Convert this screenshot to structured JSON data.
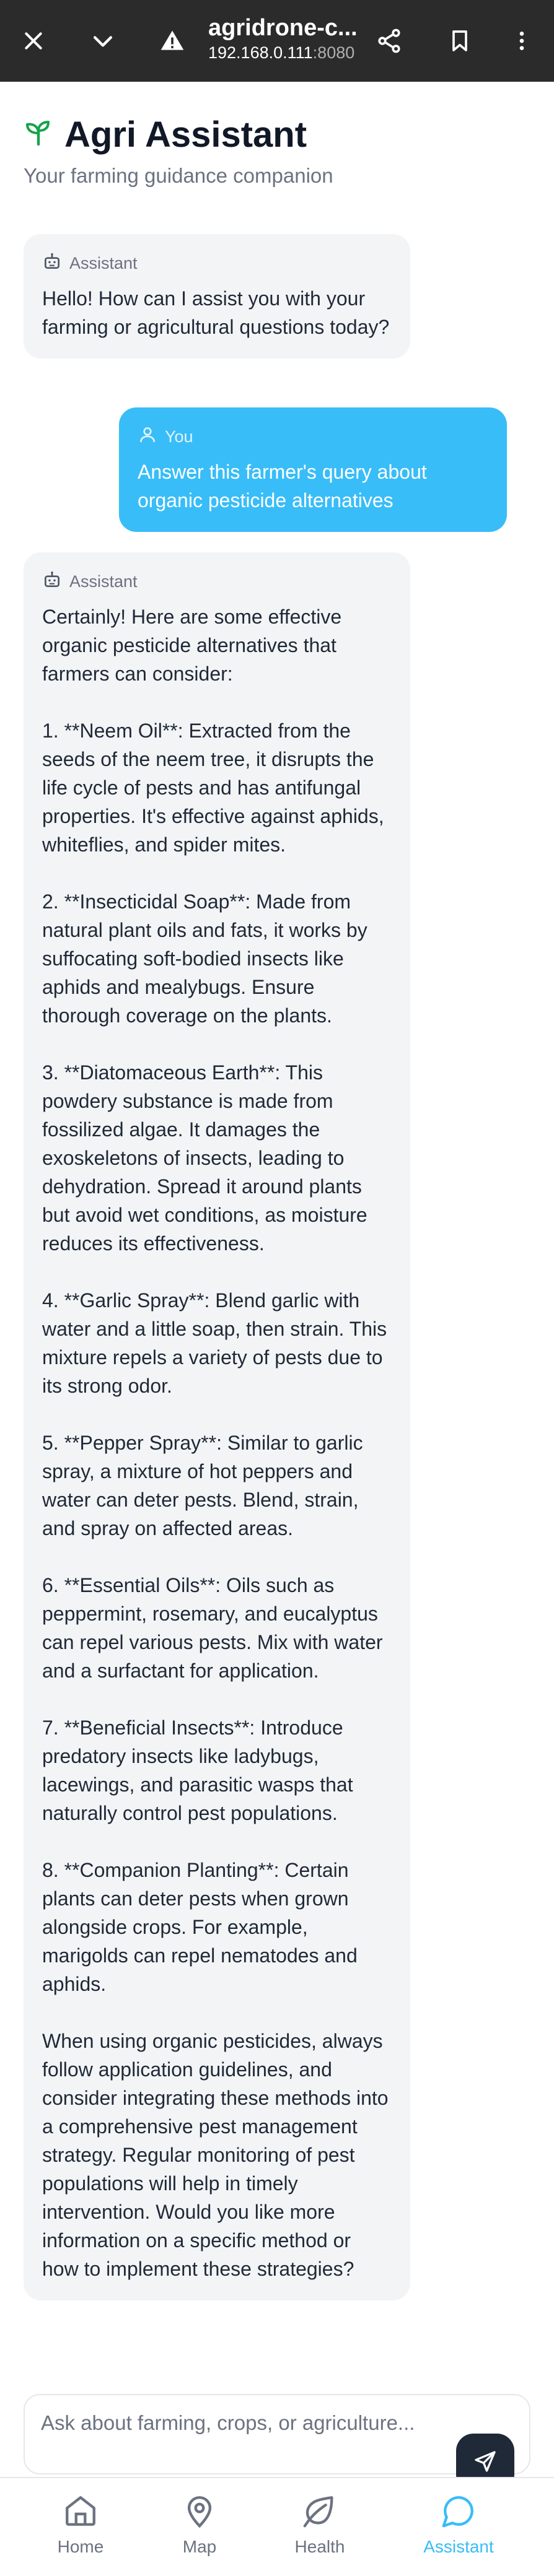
{
  "browser": {
    "title": "agridrone-c...",
    "host": "192.168.0.111",
    "port": ":8080"
  },
  "app": {
    "title": "Agri Assistant",
    "subtitle": "Your farming guidance companion"
  },
  "messages": [
    {
      "role": "assistant",
      "author": "Assistant",
      "text": "Hello! How can I assist you with your farming or agricultural questions today?"
    },
    {
      "role": "user",
      "author": "You",
      "text": "Answer this farmer's query about organic pesticide alternatives"
    },
    {
      "role": "assistant",
      "author": "Assistant",
      "text": "Certainly! Here are some effective organic pesticide alternatives that farmers can consider:\n\n1. **Neem Oil**: Extracted from the seeds of the neem tree, it disrupts the life cycle of pests and has antifungal properties. It's effective against aphids, whiteflies, and spider mites.\n\n2. **Insecticidal Soap**: Made from natural plant oils and fats, it works by suffocating soft-bodied insects like aphids and mealybugs. Ensure thorough coverage on the plants.\n\n3. **Diatomaceous Earth**: This powdery substance is made from fossilized algae. It damages the exoskeletons of insects, leading to dehydration. Spread it around plants but avoid wet conditions, as moisture reduces its effectiveness.\n\n4. **Garlic Spray**: Blend garlic with water and a little soap, then strain. This mixture repels a variety of pests due to its strong odor.\n\n5. **Pepper Spray**: Similar to garlic spray, a mixture of hot peppers and water can deter pests. Blend, strain, and spray on affected areas.\n\n6. **Essential Oils**: Oils such as peppermint, rosemary, and eucalyptus can repel various pests. Mix with water and a surfactant for application.\n\n7. **Beneficial Insects**: Introduce predatory insects like ladybugs, lacewings, and parasitic wasps that naturally control pest populations.\n\n8. **Companion Planting**: Certain plants can deter pests when grown alongside crops. For example, marigolds can repel nematodes and aphids.\n\nWhen using organic pesticides, always follow application guidelines, and consider integrating these methods into a comprehensive pest management strategy. Regular monitoring of pest populations will help in timely intervention. Would you like more information on a specific method or how to implement these strategies?"
    }
  ],
  "input": {
    "placeholder": "Ask about farming, crops, or agriculture...",
    "value": ""
  },
  "nav": [
    {
      "label": "Home",
      "icon": "home-icon",
      "active": false
    },
    {
      "label": "Map",
      "icon": "map-pin-icon",
      "active": false
    },
    {
      "label": "Health",
      "icon": "leaf-icon",
      "active": false
    },
    {
      "label": "Assistant",
      "icon": "chat-icon",
      "active": true
    }
  ],
  "colors": {
    "accent": "#38bdf8",
    "brand_icon": "#16a34a",
    "bubble_assistant": "#f3f4f6",
    "send_button": "#1f2937"
  }
}
